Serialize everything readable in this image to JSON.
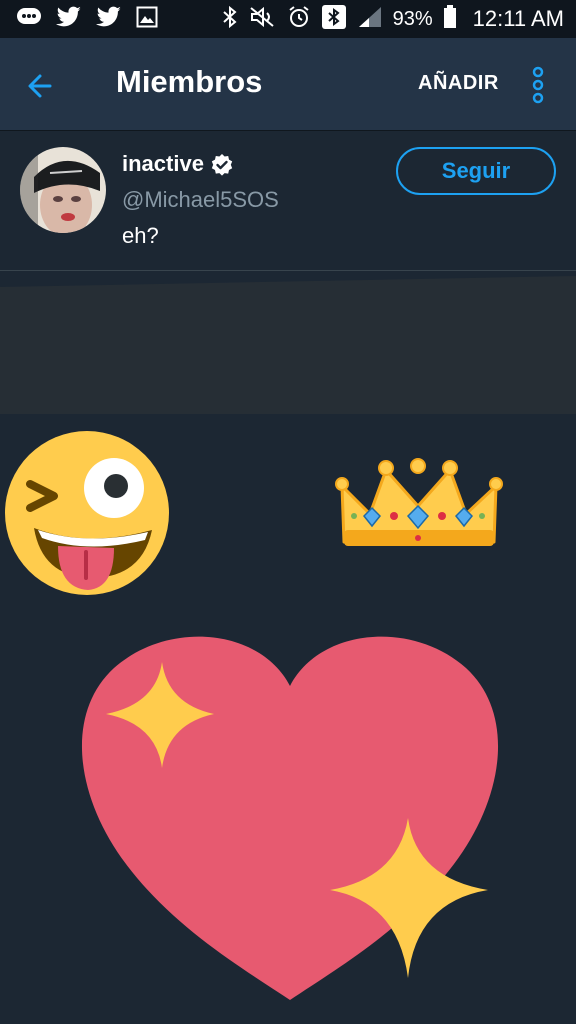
{
  "status_bar": {
    "battery_percent_label": "93%",
    "time": "12:11 AM",
    "icons": [
      "messages-icon",
      "twitter-icon",
      "twitter-icon",
      "gallery-icon",
      "bluetooth-icon",
      "mute-icon",
      "alarm-icon",
      "bluetooth-icon",
      "signal-icon",
      "battery-icon"
    ]
  },
  "appbar": {
    "title": "Miembros",
    "add_label": "AÑADIR",
    "back_icon": "arrow-left-icon",
    "more_icon": "more-vertical-icon"
  },
  "member": {
    "name": "inactive",
    "handle": "@Michael5SOS",
    "bio": "eh?",
    "verified": true,
    "follow_label": "Seguir"
  },
  "stickers": [
    "winking-face-tongue",
    "crown",
    "sparkling-heart"
  ],
  "colors": {
    "background": "#1c2733",
    "appbar": "#243447",
    "accent": "#1da1f2",
    "secondary_text": "#8899a6"
  }
}
